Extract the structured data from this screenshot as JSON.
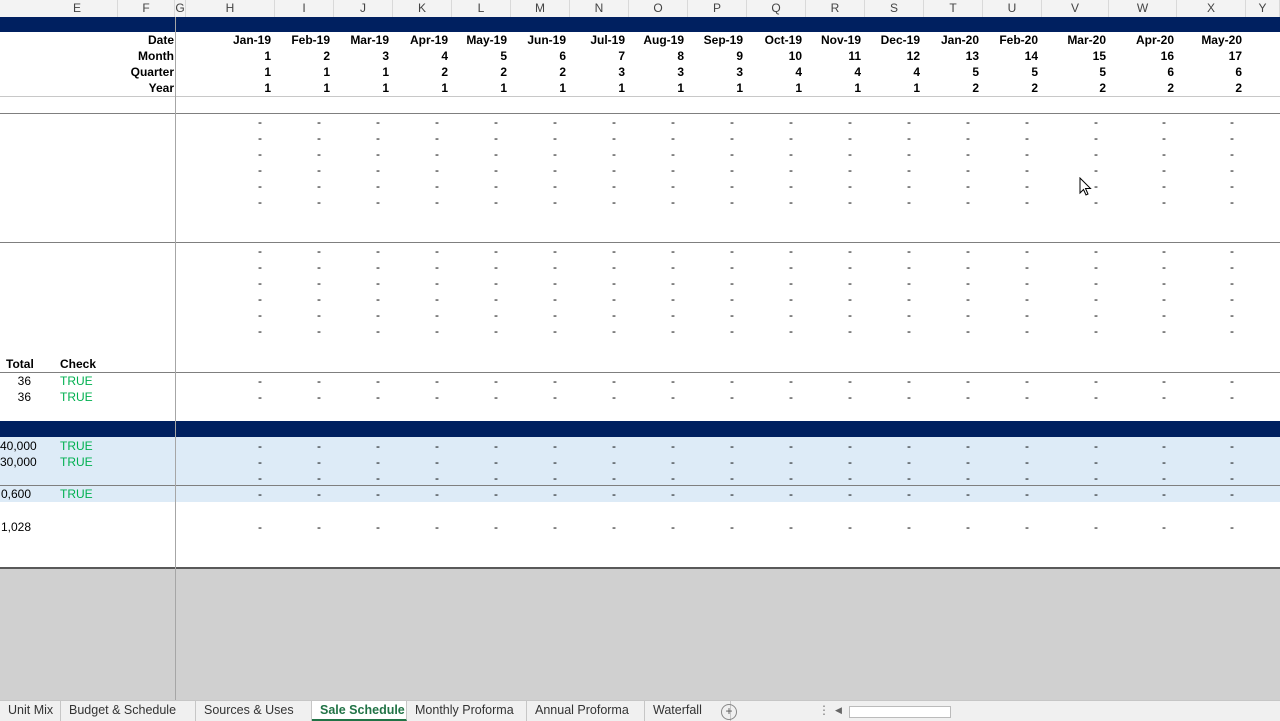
{
  "columns": [
    "E",
    "F",
    "G",
    "H",
    "I",
    "J",
    "K",
    "L",
    "M",
    "N",
    "O",
    "P",
    "Q",
    "R",
    "S",
    "T",
    "U",
    "V",
    "W",
    "X",
    "Y"
  ],
  "row_labels": {
    "date": "Date",
    "month": "Month",
    "quarter": "Quarter",
    "year": "Year"
  },
  "periods": {
    "dates": [
      "Jan-19",
      "Feb-19",
      "Mar-19",
      "Apr-19",
      "May-19",
      "Jun-19",
      "Jul-19",
      "Aug-19",
      "Sep-19",
      "Oct-19",
      "Nov-19",
      "Dec-19",
      "Jan-20",
      "Feb-20",
      "Mar-20",
      "Apr-20",
      "May-20",
      "J"
    ],
    "months": [
      "1",
      "2",
      "3",
      "4",
      "5",
      "6",
      "7",
      "8",
      "9",
      "10",
      "11",
      "12",
      "13",
      "14",
      "15",
      "16",
      "17"
    ],
    "quarters": [
      "1",
      "1",
      "1",
      "2",
      "2",
      "2",
      "3",
      "3",
      "3",
      "4",
      "4",
      "4",
      "5",
      "5",
      "5",
      "6",
      "6"
    ],
    "years": [
      "1",
      "1",
      "1",
      "1",
      "1",
      "1",
      "1",
      "1",
      "1",
      "1",
      "1",
      "1",
      "2",
      "2",
      "2",
      "2",
      "2"
    ]
  },
  "dash": "-",
  "summary_header": {
    "total": "Total",
    "check": "Check"
  },
  "summary_rows": [
    {
      "total": "36",
      "check": "TRUE"
    },
    {
      "total": "36",
      "check": "TRUE"
    }
  ],
  "blue_rows": [
    {
      "value": "40,000",
      "check": "TRUE"
    },
    {
      "value": "30,000",
      "check": "TRUE"
    },
    {
      "value": "",
      "check": ""
    },
    {
      "value": "0,600",
      "check": "TRUE"
    }
  ],
  "bottom_value": "1,028",
  "colors": {
    "band": "#002060",
    "true_green": "#00b050",
    "shade": "#ddebf7",
    "active_tab": "#217346"
  },
  "tabs": [
    {
      "label": "Unit Mix",
      "active": false
    },
    {
      "label": "Budget & Schedule",
      "active": false
    },
    {
      "label": "Sources & Uses",
      "active": false
    },
    {
      "label": "Sale Schedule",
      "active": true
    },
    {
      "label": "Monthly Proforma",
      "active": false
    },
    {
      "label": "Annual Proforma",
      "active": false
    },
    {
      "label": "Waterfall",
      "active": false
    }
  ],
  "add_sheet_icon": "plus-circle-icon",
  "add_sheet_symbol": "+",
  "scroll_left_symbol": "◀",
  "scroll_more_symbol": "⋮"
}
